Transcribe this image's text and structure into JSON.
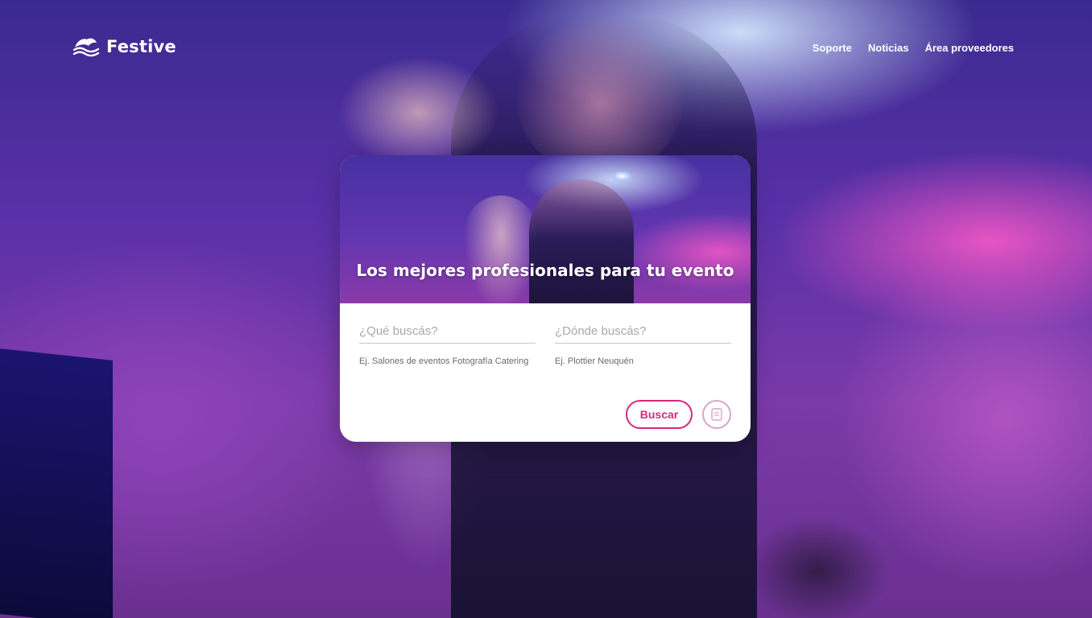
{
  "header": {
    "logo_text": "Festive",
    "logo_icon": "wave-logo-icon",
    "nav": [
      {
        "label": "Soporte"
      },
      {
        "label": "Noticias"
      },
      {
        "label": "Área proveedores"
      }
    ]
  },
  "card": {
    "title": "Los mejores profesionales para tu evento",
    "what": {
      "placeholder": "¿Qué buscás?",
      "value": "",
      "hint": "Ej. Salones de eventos Fotografía Catering"
    },
    "where": {
      "placeholder": "¿Dónde buscás?",
      "value": "",
      "hint": "Ej. Plottier Neuquén"
    },
    "search_label": "Buscar",
    "doc_icon": "document-icon"
  },
  "colors": {
    "accent": "#d6287c",
    "accent_light": "#d8a6c2",
    "text_white": "#ffffff"
  }
}
